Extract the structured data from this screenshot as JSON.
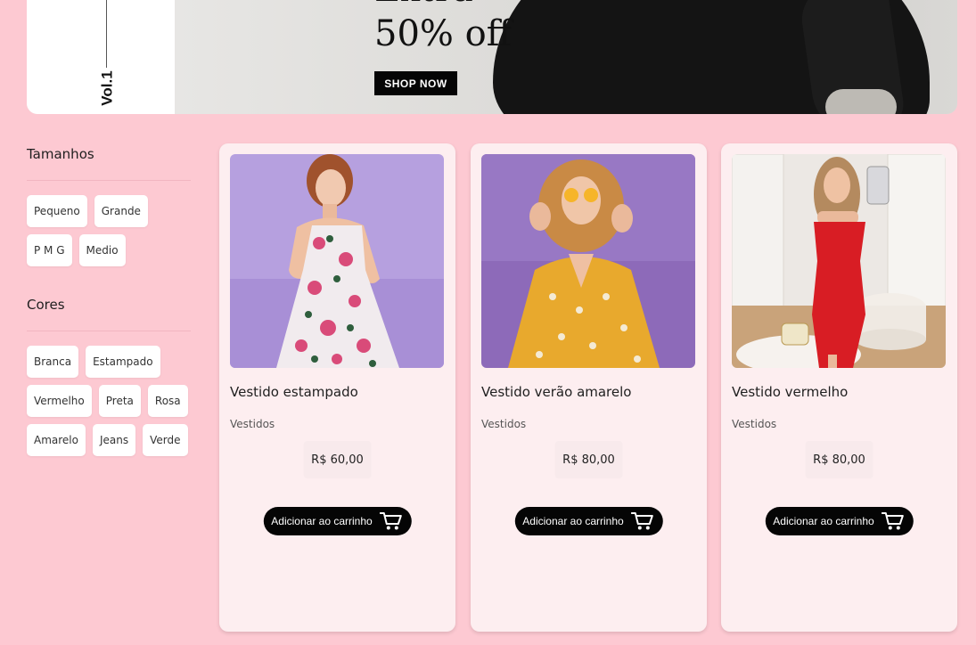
{
  "banner": {
    "vol_label": "Vol.1",
    "headline_top": "Extra",
    "headline_bottom": "50% off",
    "cta_label": "SHOP NOW"
  },
  "filters": {
    "sizes": {
      "title": "Tamanhos",
      "options": [
        "Pequeno",
        "Grande",
        "P M G",
        "Medio"
      ]
    },
    "colors": {
      "title": "Cores",
      "options": [
        "Branca",
        "Estampado",
        "Vermelho",
        "Preta",
        "Rosa",
        "Amarelo",
        "Jeans",
        "Verde"
      ]
    }
  },
  "products": [
    {
      "name": "Vestido estampado",
      "category": "Vestidos",
      "price": "R$ 60,00",
      "cart_label": "Adicionar ao carrinho",
      "image_bg": "#b6a0df",
      "dress_color": "#ece8ea"
    },
    {
      "name": "Vestido verão amarelo",
      "category": "Vestidos",
      "price": "R$ 80,00",
      "cart_label": "Adicionar ao carrinho",
      "image_bg": "#8d6ab9",
      "dress_color": "#e8a92d"
    },
    {
      "name": "Vestido vermelho",
      "category": "Vestidos",
      "price": "R$ 80,00",
      "cart_label": "Adicionar ao carrinho",
      "image_bg": "#ece8e4",
      "dress_color": "#d81d24"
    }
  ],
  "icons": {
    "cart": "cart-icon"
  }
}
